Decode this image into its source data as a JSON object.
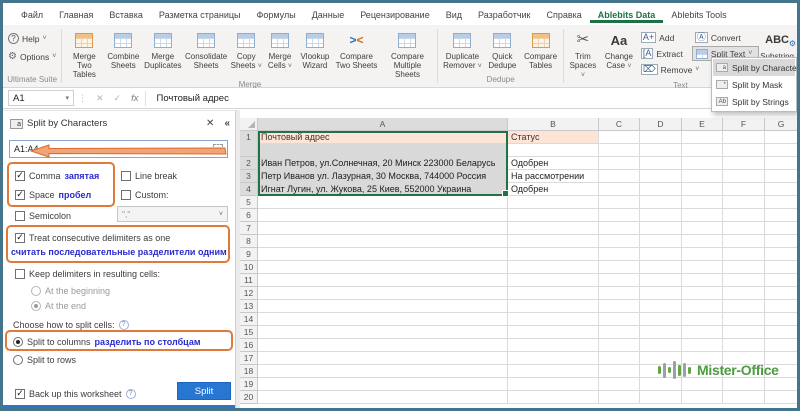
{
  "tabs": [
    "Файл",
    "Главная",
    "Вставка",
    "Разметка страницы",
    "Формулы",
    "Данные",
    "Рецензирование",
    "Вид",
    "Разработчик",
    "Справка",
    "Ablebits Data",
    "Ablebits Tools"
  ],
  "active_tab": "Ablebits Data",
  "ribbon": {
    "ultimate": {
      "label": "Ultimate Suite",
      "help": "Help",
      "options": "Options"
    },
    "merge": {
      "label": "Merge",
      "buttons": [
        "Merge Two Tables",
        "Combine Sheets",
        "Merge Duplicates",
        "Consolidate Sheets",
        "Copy Sheets",
        "Merge Cells",
        "Vlookup Wizard",
        "Compare Two Sheets",
        "Compare Multiple Sheets"
      ]
    },
    "dedupe": {
      "label": "Dedupe",
      "buttons": [
        "Duplicate Remover",
        "Quick Dedupe",
        "Compare Tables"
      ]
    },
    "text": {
      "label": "Text",
      "trim": "Trim Spaces",
      "change_case": "Change Case",
      "add": "Add",
      "extract": "Extract",
      "remove": "Remove",
      "convert": "Convert",
      "split_text": "Split Text",
      "abc": "ABC",
      "substring": "Substring"
    }
  },
  "split_menu": {
    "items": [
      {
        "label": "Split by Characters",
        "selected": true
      },
      {
        "label": "Split by Mask",
        "selected": false
      },
      {
        "label": "Split by Strings",
        "selected": false
      }
    ]
  },
  "formula_bar": {
    "name_box": "A1",
    "formula": "Почтовый адрес"
  },
  "panel": {
    "title": "Split by Characters",
    "range": "A1:A4",
    "comma": "Comma",
    "comma_note": "запятая",
    "space": "Space",
    "space_note": "пробел",
    "semicolon": "Semicolon",
    "line_break": "Line break",
    "custom": "Custom:",
    "custom_value": "\",\"",
    "treat": "Treat consecutive delimiters as one",
    "treat_note": "считать последовательные разделители одним",
    "keep": "Keep delimiters in resulting cells:",
    "at_beginning": "At the beginning",
    "at_end": "At the end",
    "choose": "Choose how to split cells:",
    "split_columns": "Split to columns",
    "split_columns_note": "разделить по столбцам",
    "split_rows": "Split to rows",
    "backup": "Back up this worksheet",
    "split_button": "Split"
  },
  "sheet": {
    "columns": [
      "A",
      "B",
      "C",
      "D",
      "E",
      "F",
      "G"
    ],
    "row_numbers": [
      "1",
      "2",
      "3",
      "4",
      "5",
      "6",
      "7",
      "8",
      "9",
      "10",
      "11",
      "12",
      "13",
      "14",
      "15",
      "16",
      "17",
      "18",
      "19",
      "20"
    ],
    "selected_range": "A1:A4",
    "cells": {
      "A1": "Почтовый адрес",
      "B1": "Статус",
      "A2": "Иван Петров, ул.Солнечная, 20 Минск 223000 Беларусь",
      "B2": "Одобрен",
      "A3": "Петр Иванов ул. Лазурная, 30 Москва, 744000 Россия",
      "B3": "На рассмотрении",
      "A4": "Игнат Лугин,  ул. Жукова,  25 Киев,  552000 Украина",
      "B4": "Одобрен"
    }
  },
  "logo": {
    "text": "Mister-Office"
  },
  "glyphs": {
    "chevron": "˅",
    "caret_down": "▾",
    "close": "✕",
    "check": "✓",
    "fx": "fx",
    "dots": "⋮",
    "collapse": "«",
    "help_q": "?",
    "select_range": "⛶",
    "scissors": "✂",
    "gear": "⚙",
    "aa": "Aa",
    "cmp_gt": ">",
    "cmp_lt": "<",
    "add_glyph": "A+",
    "extract_glyph": "[A",
    "remove_glyph": "⌦",
    "convert_glyph": "Ⓐ",
    "title_a": "a",
    "mi_chars": "a",
    "mi_mask": "*",
    "mi_strings": "Ab"
  },
  "colors": {
    "annotation_orange": "#e0793a",
    "note_blue": "#2a2acc",
    "excel_green": "#217346",
    "header_fill": "#fce4d6",
    "selection_gray": "#d9d9d9",
    "split_button_blue": "#2776d2",
    "logo_green": "#4d9b40",
    "active_tab_green": "#1e7145"
  }
}
